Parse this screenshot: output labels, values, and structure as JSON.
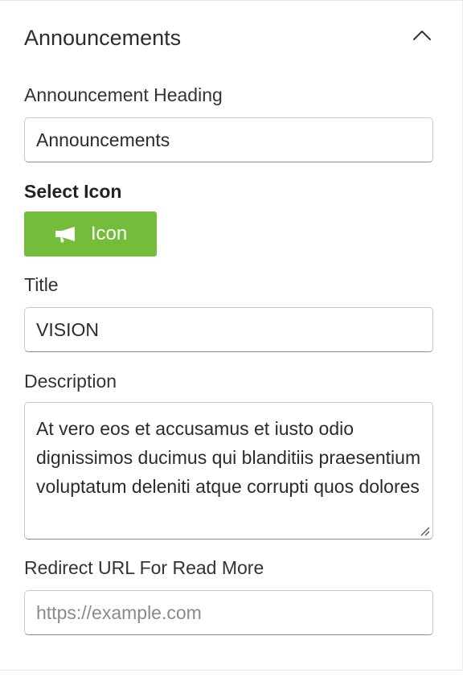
{
  "section": {
    "title": "Announcements",
    "collapse_icon": "chevron-up-icon"
  },
  "fields": {
    "heading": {
      "label": "Announcement Heading",
      "value": "Announcements"
    },
    "icon": {
      "label": "Select Icon",
      "button_label": "Icon",
      "button_icon": "megaphone-icon",
      "button_color": "#74bd3a"
    },
    "title": {
      "label": "Title",
      "value": "VISION"
    },
    "description": {
      "label": "Description",
      "value": "At vero eos et accusamus et iusto odio dignissimos ducimus qui blanditiis praesentium voluptatum deleniti atque corrupti quos dolores"
    },
    "redirect_url": {
      "label": "Redirect URL For Read More",
      "value": "",
      "placeholder": "https://example.com"
    }
  }
}
